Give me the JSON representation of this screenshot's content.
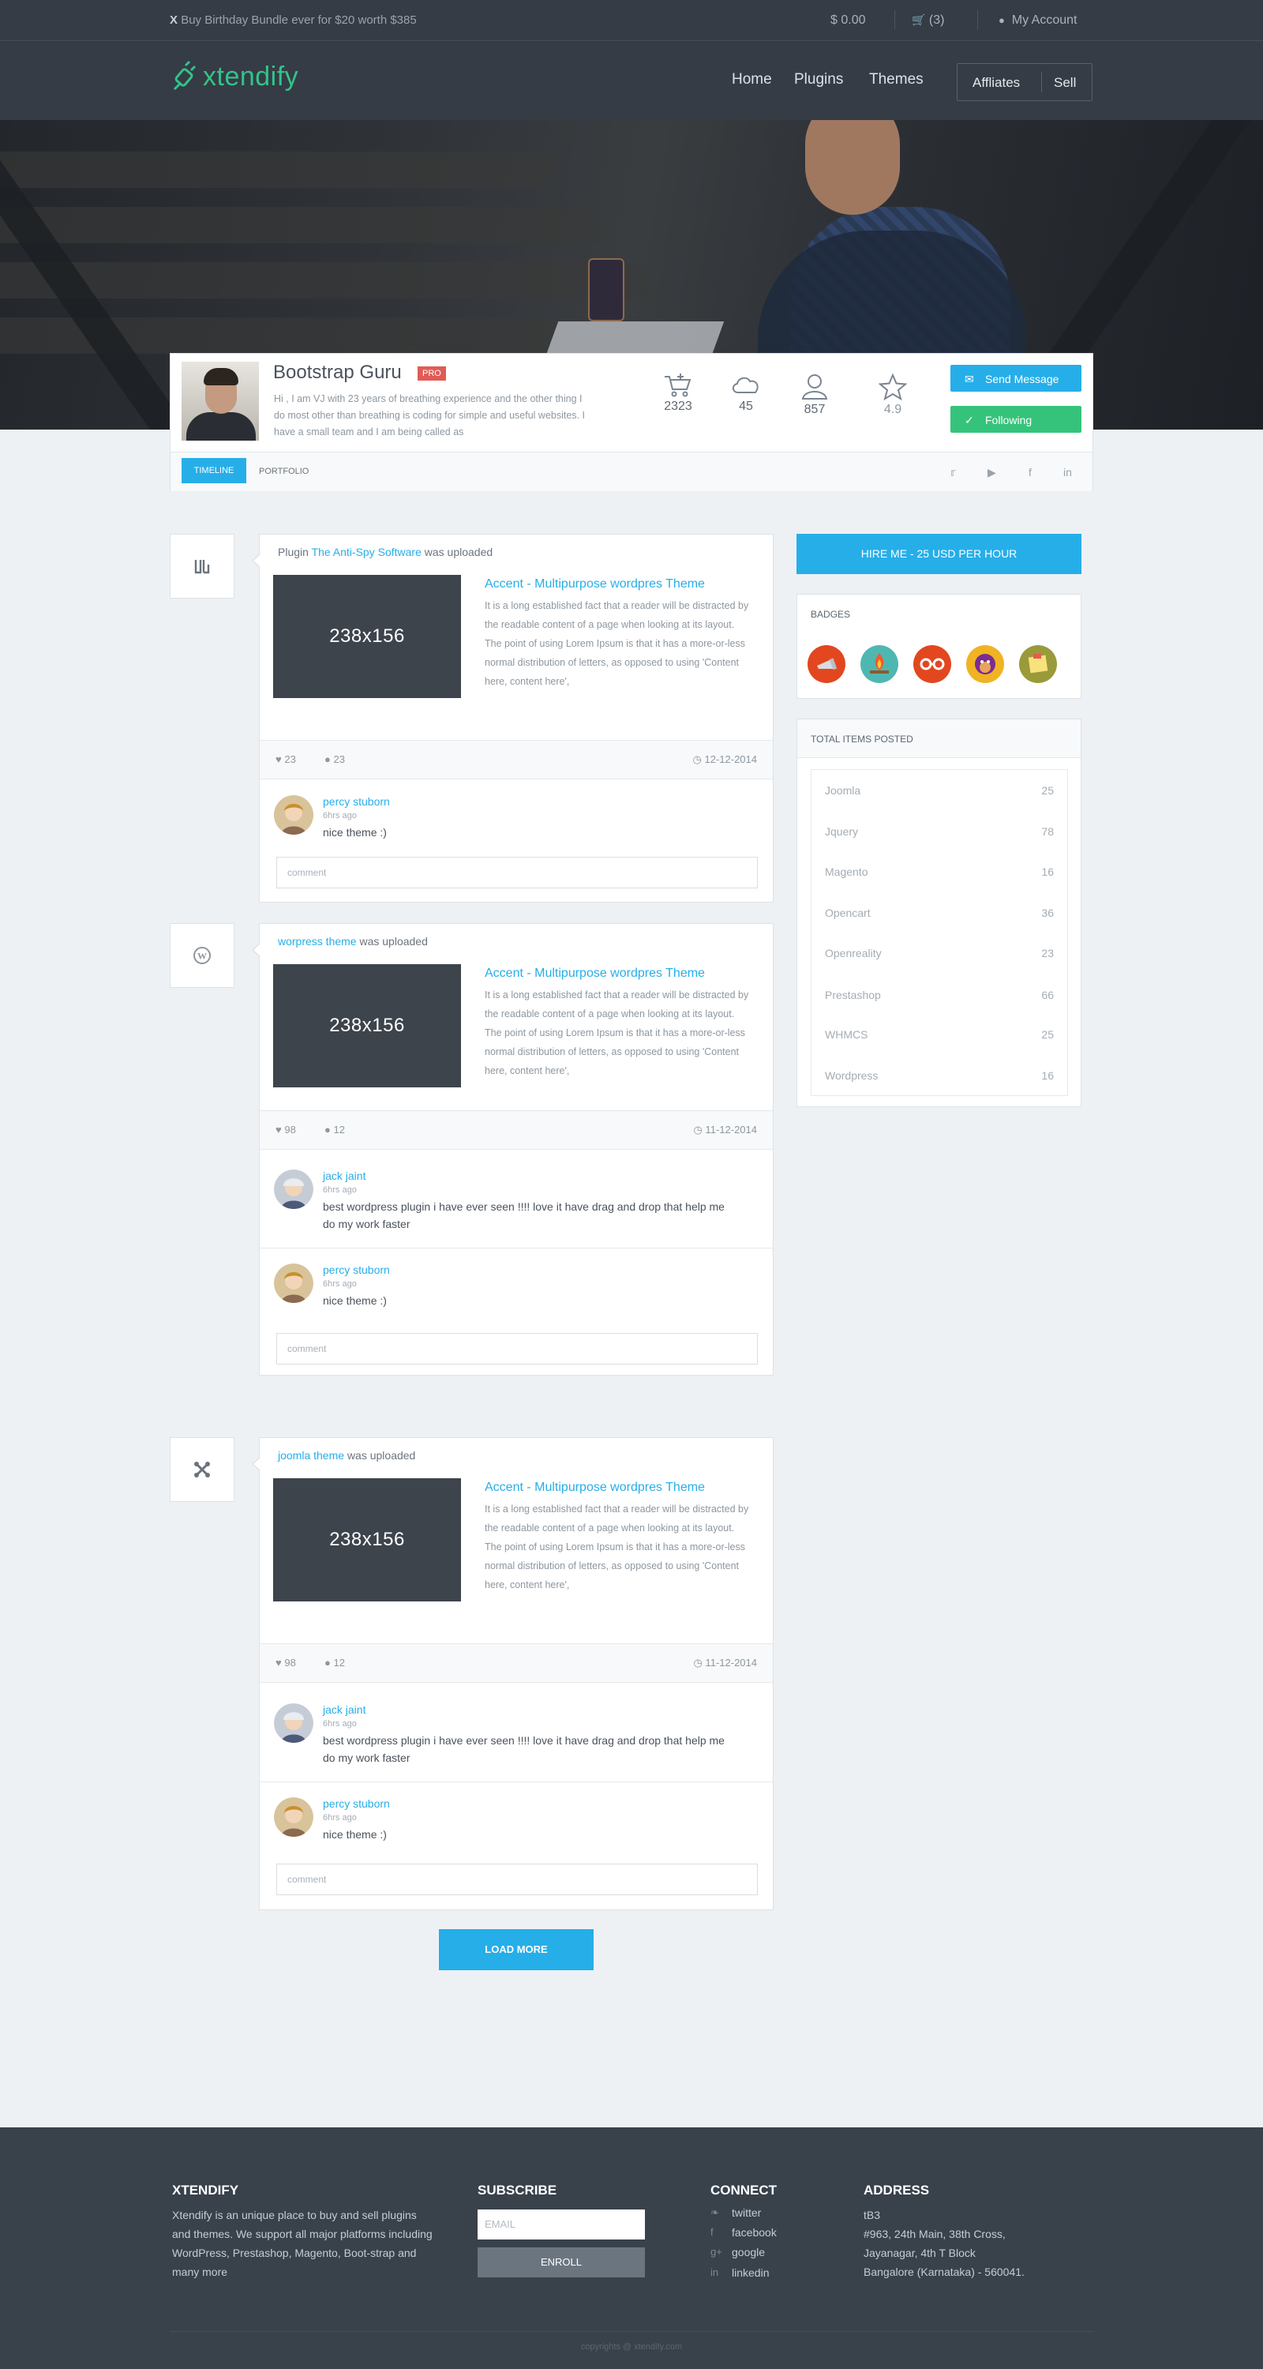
{
  "topbar": {
    "promo_prefix": "X",
    "promo_text": "Buy Birthday Bundle ever for $20 worth $385",
    "balance": "$ 0.00",
    "cart": "(3)",
    "account": "My Account"
  },
  "header": {
    "logo": "xtendify",
    "nav": [
      "Home",
      "Plugins",
      "Themes"
    ],
    "affiliates": "Affliates",
    "sell": "Sell"
  },
  "profile": {
    "name": "Bootstrap Guru",
    "badge": "PRO",
    "bio": "Hi , I am VJ with 23 years of breathing experience and the other thing I do most other than breathing is coding for simple and useful websites. I have a small team and I am being called as",
    "stats": {
      "sales": "2323",
      "downloads": "45",
      "followers": "857",
      "rating": "4.9"
    },
    "send_message": "Send Message",
    "following": "Following",
    "tabs": {
      "timeline": "TIMELINE",
      "portfolio": "PORTFOLIO"
    }
  },
  "posts": [
    {
      "head_prefix": "Plugin ",
      "head_link": "The Anti-Spy Software",
      "head_suffix": " was uploaded",
      "thumb": "238x156",
      "title": "Accent - Multipurpose wordpres Theme",
      "desc": "It is a long established fact that a reader will be distracted by the readable content of a page when looking at its layout. The point of using Lorem Ipsum is that it has a more-or-less normal distribution of letters, as opposed to using 'Content here, content here',",
      "likes": "23",
      "comments": "23",
      "date": "12-12-2014",
      "comment_list": [
        {
          "name": "percy stuborn",
          "time": "6hrs ago",
          "text": "nice theme :)"
        }
      ],
      "comment_placeholder": "comment"
    },
    {
      "head_prefix": "",
      "head_link": "worpress theme",
      "head_suffix": " was uploaded",
      "thumb": "238x156",
      "title": "Accent - Multipurpose wordpres Theme",
      "desc": "It is a long established fact that a reader will be distracted by the readable content of a page when looking at its layout. The point of using Lorem Ipsum is that it has a more-or-less normal distribution of letters, as opposed to using 'Content here, content here',",
      "likes": "98",
      "comments": "12",
      "date": "11-12-2014",
      "comment_list": [
        {
          "name": "jack jaint",
          "time": "6hrs ago",
          "text": "best wordpress plugin i have ever seen !!!! love it have drag and drop that help me do my work faster"
        },
        {
          "name": "percy stuborn",
          "time": "6hrs ago",
          "text": "nice theme :)"
        }
      ],
      "comment_placeholder": "comment"
    },
    {
      "head_prefix": "",
      "head_link": "joomla theme",
      "head_suffix": " was uploaded",
      "thumb": "238x156",
      "title": "Accent - Multipurpose wordpres Theme",
      "desc": "It is a long established fact that a reader will be distracted by the readable content of a page when looking at its layout. The point of using Lorem Ipsum is that it has a more-or-less normal distribution of letters, as opposed to using 'Content here, content here',",
      "likes": "98",
      "comments": "12",
      "date": "11-12-2014",
      "comment_list": [
        {
          "name": "jack jaint",
          "time": "6hrs ago",
          "text": "best wordpress plugin i have ever seen !!!! love it have drag and drop that help me do my work faster"
        },
        {
          "name": "percy stuborn",
          "time": "6hrs ago",
          "text": "nice theme :)"
        }
      ],
      "comment_placeholder": "comment"
    }
  ],
  "load_more": "LOAD MORE",
  "sidebar": {
    "hire": "HIRE ME - 25 USD PER HOUR",
    "badges_title": "BADGES",
    "badge_colors": [
      "#e2471f",
      "#4fb7b2",
      "#e2471f",
      "#f0b323",
      "#9a9a3a"
    ],
    "totals_title": "TOTAL ITEMS POSTED",
    "totals": [
      {
        "label": "Joomla",
        "count": "25"
      },
      {
        "label": "Jquery",
        "count": "78"
      },
      {
        "label": "Magento",
        "count": "16"
      },
      {
        "label": "Opencart",
        "count": "36"
      },
      {
        "label": "Openreality",
        "count": "23"
      },
      {
        "label": "Prestashop",
        "count": "66"
      },
      {
        "label": "WHMCS",
        "count": "25"
      },
      {
        "label": "Wordpress",
        "count": "16"
      }
    ]
  },
  "footer": {
    "about_title": "XTENDIFY",
    "about_text": "Xtendify is an unique place to buy and sell plugins and themes. We support all major platforms including WordPress, Prestashop, Magento, Boot-strap and many more",
    "subscribe_title": "SUBSCRIBE",
    "email_placeholder": "EMAIL",
    "enroll": "ENROLL",
    "connect_title": "CONNECT",
    "connect": [
      "twitter",
      "facebook",
      "google",
      "linkedin"
    ],
    "address_title": "ADDRESS",
    "address": [
      "tB3",
      "#963, 24th Main, 38th Cross,",
      "Jayanagar, 4th T Block",
      "Bangalore (Karnataka) - 560041."
    ],
    "copyright": "copyrights @ xtendify.com"
  },
  "colors": {
    "accent": "#26aee9",
    "success": "#35c37b",
    "pro": "#e15b56",
    "dark": "#353c45",
    "logo": "#33c38a"
  }
}
